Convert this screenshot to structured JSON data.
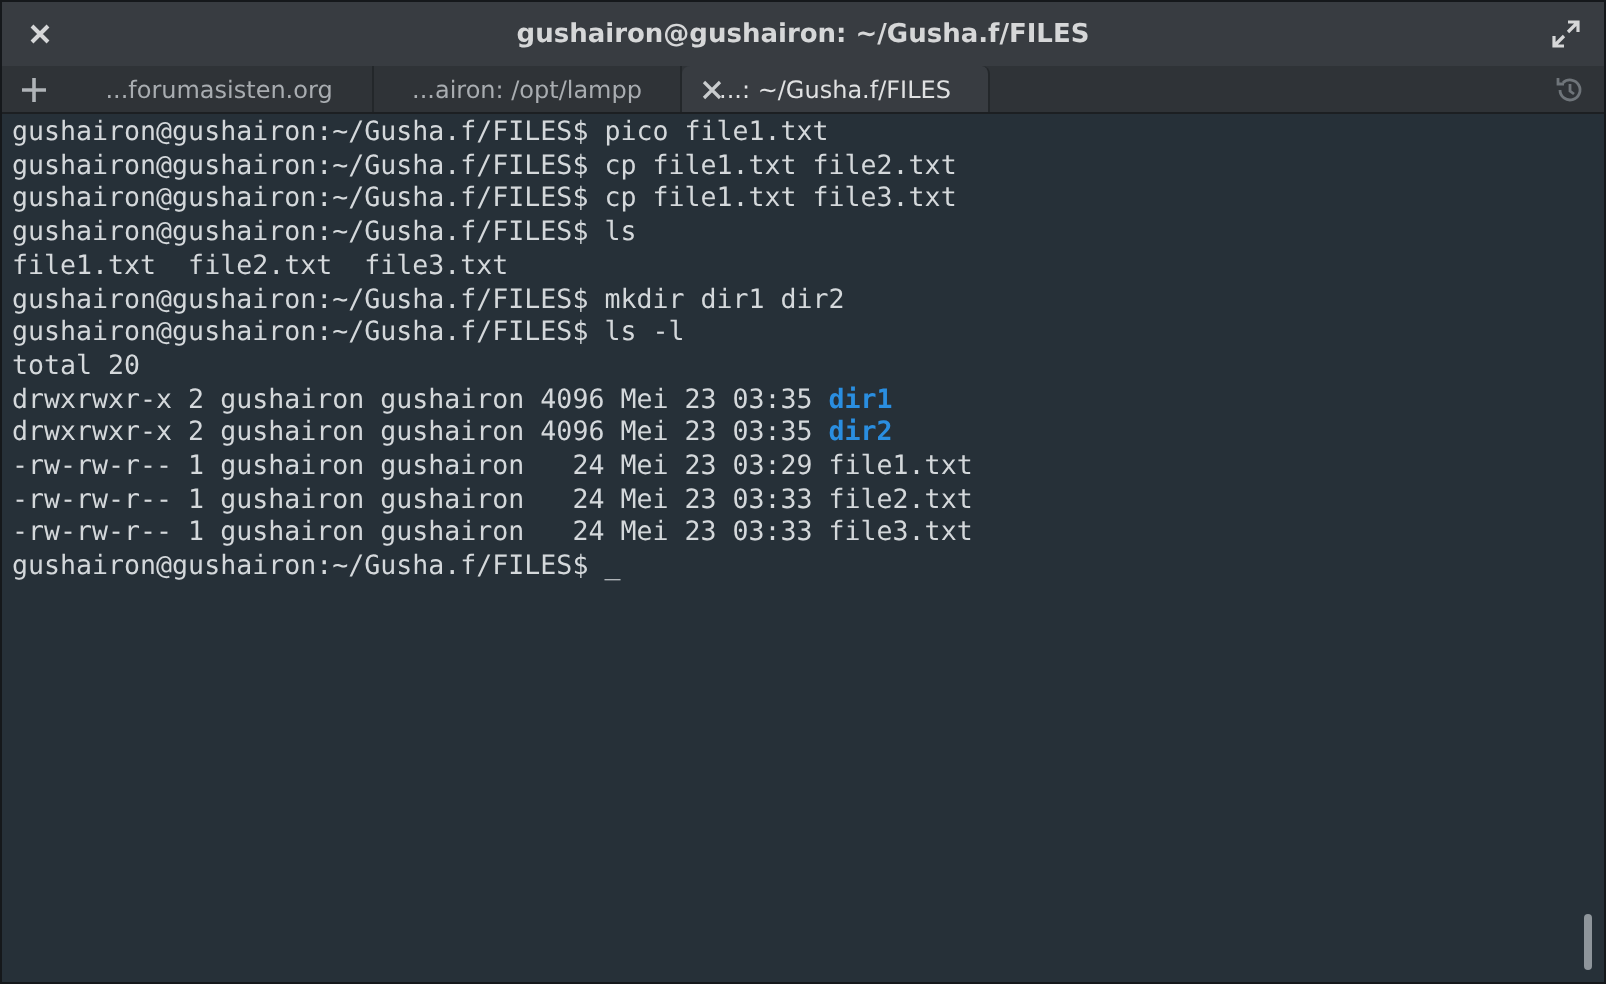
{
  "window": {
    "title": "gushairon@gushairon: ~/Gusha.f/FILES"
  },
  "tabs": [
    {
      "label": "...forumasisten.org",
      "selected": false
    },
    {
      "label": "...airon: /opt/lampp",
      "selected": false
    },
    {
      "label": "...: ~/Gusha.f/FILES",
      "selected": true
    }
  ],
  "terminal": {
    "lines": [
      [
        {
          "kind": "plain",
          "text": "gushairon@gushairon:~/Gusha.f/FILES$ pico file1.txt"
        }
      ],
      [
        {
          "kind": "plain",
          "text": "gushairon@gushairon:~/Gusha.f/FILES$ cp file1.txt file2.txt"
        }
      ],
      [
        {
          "kind": "plain",
          "text": "gushairon@gushairon:~/Gusha.f/FILES$ cp file1.txt file3.txt"
        }
      ],
      [
        {
          "kind": "plain",
          "text": "gushairon@gushairon:~/Gusha.f/FILES$ ls"
        }
      ],
      [
        {
          "kind": "plain",
          "text": "file1.txt  file2.txt  file3.txt"
        }
      ],
      [
        {
          "kind": "plain",
          "text": "gushairon@gushairon:~/Gusha.f/FILES$ mkdir dir1 dir2"
        }
      ],
      [
        {
          "kind": "plain",
          "text": "gushairon@gushairon:~/Gusha.f/FILES$ ls -l"
        }
      ],
      [
        {
          "kind": "plain",
          "text": "total 20"
        }
      ],
      [
        {
          "kind": "plain",
          "text": "drwxrwxr-x 2 gushairon gushairon 4096 Mei 23 03:35 "
        },
        {
          "kind": "dir",
          "text": "dir1"
        }
      ],
      [
        {
          "kind": "plain",
          "text": "drwxrwxr-x 2 gushairon gushairon 4096 Mei 23 03:35 "
        },
        {
          "kind": "dir",
          "text": "dir2"
        }
      ],
      [
        {
          "kind": "plain",
          "text": "-rw-rw-r-- 1 gushairon gushairon   24 Mei 23 03:29 file1.txt"
        }
      ],
      [
        {
          "kind": "plain",
          "text": "-rw-rw-r-- 1 gushairon gushairon   24 Mei 23 03:33 file2.txt"
        }
      ],
      [
        {
          "kind": "plain",
          "text": "-rw-rw-r-- 1 gushairon gushairon   24 Mei 23 03:33 file3.txt"
        }
      ],
      [
        {
          "kind": "plain",
          "text": "gushairon@gushairon:~/Gusha.f/FILES$ "
        },
        {
          "kind": "cursor",
          "text": "_"
        }
      ]
    ]
  }
}
